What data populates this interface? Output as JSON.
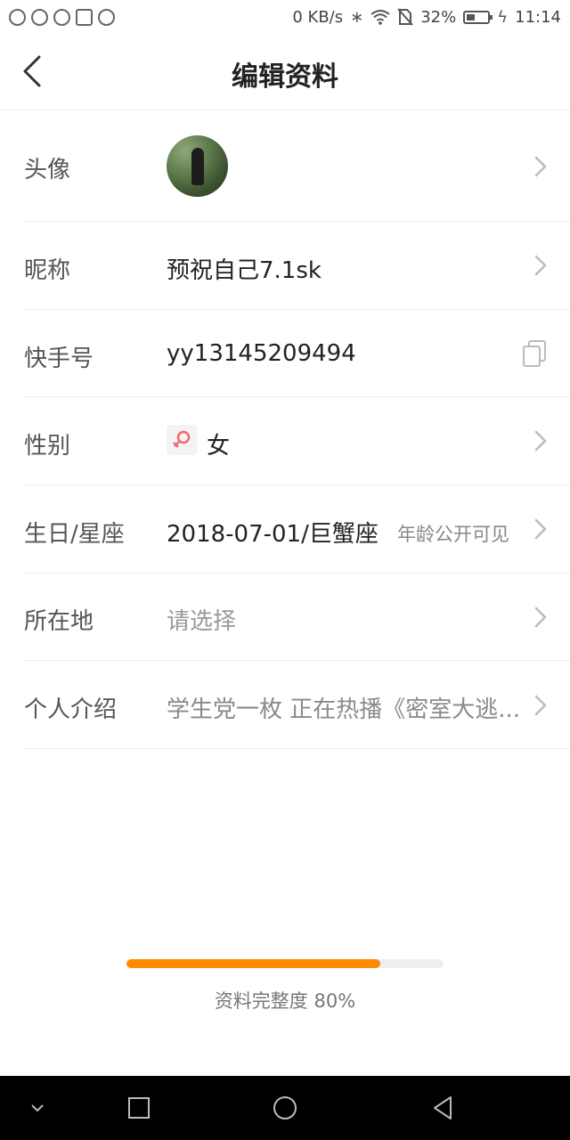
{
  "status_bar": {
    "network_speed": "0 KB/s",
    "battery": "32%",
    "time": "11:14",
    "bluetooth_glyph": "∗",
    "charging_glyph": "ϟ"
  },
  "header": {
    "title": "编辑资料"
  },
  "rows": {
    "avatar": {
      "label": "头像"
    },
    "nickname": {
      "label": "昵称",
      "value": "预祝自己7.1sk"
    },
    "kuaishou_id": {
      "label": "快手号",
      "value": "yy13145209494"
    },
    "gender": {
      "label": "性别",
      "value": "女"
    },
    "birthday": {
      "label": "生日/星座",
      "value": "2018-07-01/巨蟹座",
      "note": "年龄公开可见"
    },
    "location": {
      "label": "所在地",
      "value": "请选择"
    },
    "bio": {
      "label": "个人介绍",
      "value": "学生党一枚  正在热播《密室大逃..."
    }
  },
  "progress": {
    "label": "资料完整度 80%",
    "fraction": 0.8,
    "color": "#ff8a00"
  },
  "icons": {
    "back": "back-arrow-icon",
    "chevron": "chevron-right-icon",
    "copy": "copy-icon",
    "gender": "female-icon"
  }
}
